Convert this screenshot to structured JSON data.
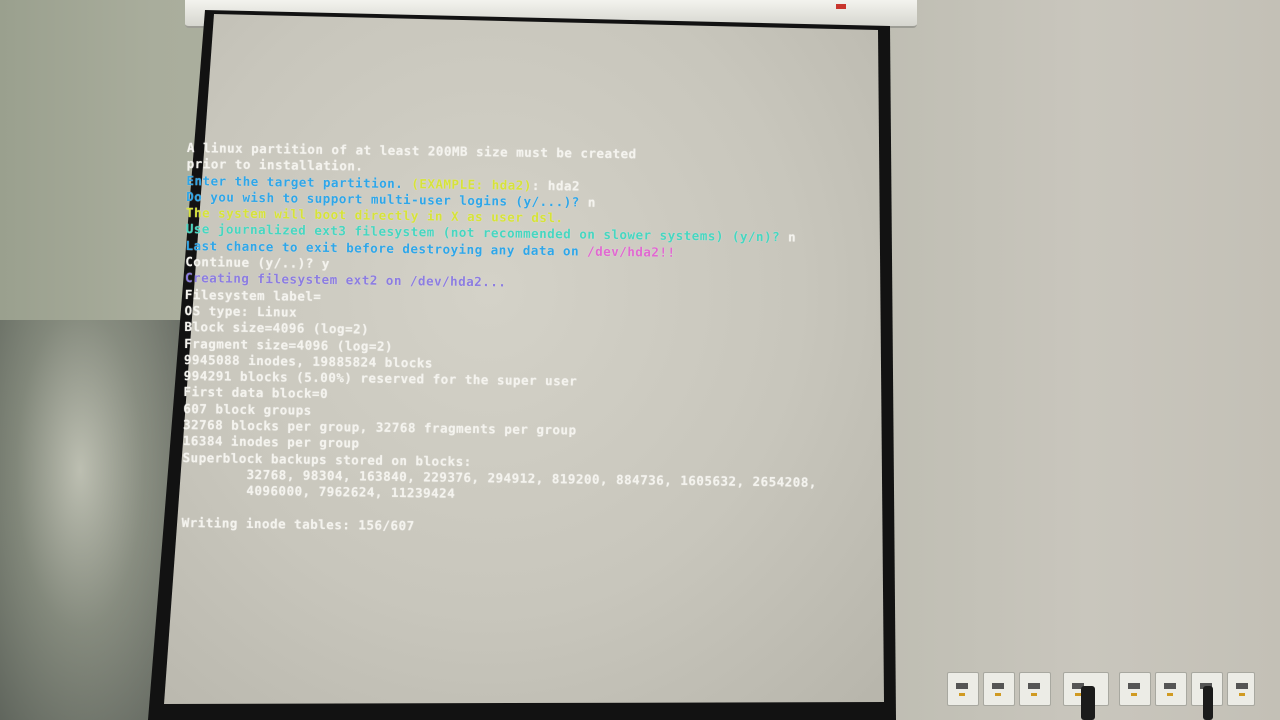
{
  "terminal": {
    "lines": [
      {
        "segments": [
          {
            "text": "A linux partition of at least 200MB size must be created",
            "color": "white"
          }
        ]
      },
      {
        "segments": [
          {
            "text": "prior to installation.",
            "color": "white"
          }
        ]
      },
      {
        "segments": [
          {
            "text": "Enter the target partition. ",
            "color": "cyan"
          },
          {
            "text": "(EXAMPLE: hda2)",
            "color": "yellow"
          },
          {
            "text": ": hda2",
            "color": "white"
          }
        ]
      },
      {
        "segments": [
          {
            "text": "Do you wish to support multi-user logins (y/...)?",
            "color": "cyan"
          },
          {
            "text": " n",
            "color": "white"
          }
        ]
      },
      {
        "segments": [
          {
            "text": "The system will boot directly in X as user dsl.",
            "color": "yellow"
          }
        ]
      },
      {
        "segments": [
          {
            "text": "Use journalized ext3 filesystem (not recommended on slower systems) (y/n)?",
            "color": "green"
          },
          {
            "text": " n",
            "color": "white"
          }
        ]
      },
      {
        "segments": [
          {
            "text": "Last chance to exit before destroying any data on ",
            "color": "cyan"
          },
          {
            "text": "/dev/hda2!!",
            "color": "magenta"
          }
        ]
      },
      {
        "segments": [
          {
            "text": "Continue (y/..)? y",
            "color": "white"
          }
        ]
      },
      {
        "segments": [
          {
            "text": "Creating filesystem ext2 on /dev/hda2...",
            "color": "violet"
          }
        ]
      },
      {
        "segments": [
          {
            "text": "Filesystem label=",
            "color": "white"
          }
        ]
      },
      {
        "segments": [
          {
            "text": "OS type: Linux",
            "color": "white"
          }
        ]
      },
      {
        "segments": [
          {
            "text": "Block size=4096 (log=2)",
            "color": "white"
          }
        ]
      },
      {
        "segments": [
          {
            "text": "Fragment size=4096 (log=2)",
            "color": "white"
          }
        ]
      },
      {
        "segments": [
          {
            "text": "9945088 inodes, 19885824 blocks",
            "color": "white"
          }
        ]
      },
      {
        "segments": [
          {
            "text": "994291 blocks (5.00%) reserved for the super user",
            "color": "white"
          }
        ]
      },
      {
        "segments": [
          {
            "text": "First data block=0",
            "color": "white"
          }
        ]
      },
      {
        "segments": [
          {
            "text": "607 block groups",
            "color": "white"
          }
        ]
      },
      {
        "segments": [
          {
            "text": "32768 blocks per group, 32768 fragments per group",
            "color": "white"
          }
        ]
      },
      {
        "segments": [
          {
            "text": "16384 inodes per group",
            "color": "white"
          }
        ]
      },
      {
        "segments": [
          {
            "text": "Superblock backups stored on blocks:",
            "color": "white"
          }
        ]
      },
      {
        "segments": [
          {
            "text": "        32768, 98304, 163840, 229376, 294912, 819200, 884736, 1605632, 2654208,",
            "color": "white"
          }
        ]
      },
      {
        "segments": [
          {
            "text": "        4096000, 7962624, 11239424",
            "color": "white"
          }
        ]
      },
      {
        "segments": [
          {
            "text": "",
            "color": "white"
          }
        ]
      },
      {
        "segments": [
          {
            "text": "Writing inode tables: 156/607",
            "color": "white"
          }
        ]
      }
    ]
  },
  "colors": {
    "white": "#f4f3ee",
    "cyan": "#2fa6e8",
    "yellow": "#d6e23a",
    "green": "#47d6c0",
    "violet": "#8c7de0",
    "magenta": "#e06ad0"
  }
}
